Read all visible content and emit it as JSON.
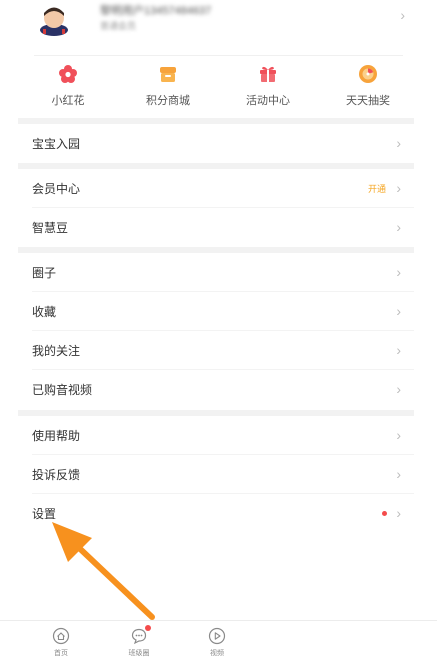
{
  "profile": {
    "name": "黎明用户13457484637",
    "subtitle": "普通会员"
  },
  "quick_actions": [
    {
      "label": "小红花",
      "icon": "flower-icon",
      "color": "#f0505a"
    },
    {
      "label": "积分商城",
      "icon": "shop-icon",
      "color": "#f7a33b"
    },
    {
      "label": "活动中心",
      "icon": "gift-icon",
      "color": "#f0505a"
    },
    {
      "label": "天天抽奖",
      "icon": "lottery-icon",
      "color": "#f7a33b"
    }
  ],
  "menu": {
    "baby_garden": "宝宝入园",
    "member_center": "会员中心",
    "member_open": "开通",
    "wisdom_beans": "智慧豆",
    "circle": "圈子",
    "favorites": "收藏",
    "following": "我的关注",
    "purchased_media": "已购音视频",
    "help": "使用帮助",
    "feedback": "投诉反馈",
    "settings": "设置"
  },
  "tabbar": [
    {
      "label": "首页",
      "icon": "home-icon"
    },
    {
      "label": "班级圈",
      "icon": "chat-icon"
    },
    {
      "label": "视频",
      "icon": "play-icon"
    }
  ],
  "accent_colors": {
    "arrow": "#f7911e",
    "badge": "#f44b4b",
    "tag": "#f5a623"
  }
}
